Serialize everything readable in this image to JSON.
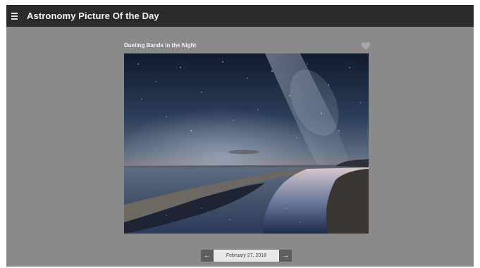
{
  "header": {
    "title": "Astronomy Picture Of the Day",
    "menu_icon": "hamburger-menu-icon"
  },
  "card": {
    "title": "Dueling Bands in the Night",
    "favorite_icon": "heart-icon"
  },
  "pager": {
    "prev_icon": "arrow-left-icon",
    "next_icon": "arrow-right-icon",
    "prev_glyph": "←",
    "next_glyph": "→",
    "date": "February 27, 2018"
  },
  "colors": {
    "header_bg": "#2b2b2b",
    "page_bg": "#8a8a8a",
    "pager_button": "#5e5e5e",
    "pager_date_bg": "#e8e8e8"
  }
}
